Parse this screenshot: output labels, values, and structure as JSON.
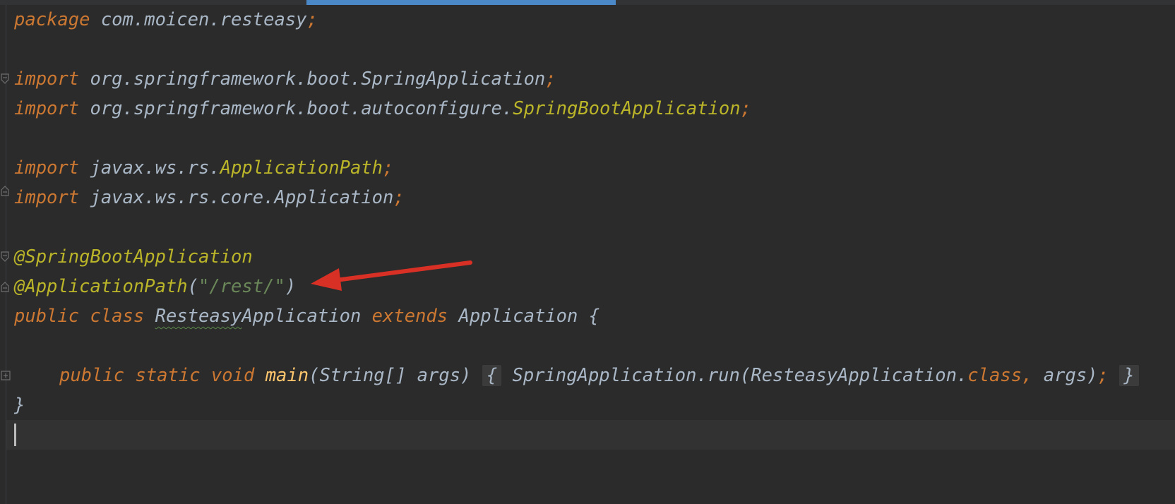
{
  "colors": {
    "background": "#2b2b2b",
    "keyword": "#cc7832",
    "annotation": "#bbb529",
    "string": "#6a8759",
    "method": "#ffc66d",
    "plain": "#a9b7c6",
    "arrow": "#d93025",
    "tab_indicator": "#4a88c7"
  },
  "code": {
    "l1": {
      "kw": "package",
      "pkg": " com.moicen.resteasy",
      "semi": ";"
    },
    "l3": {
      "kw": "import",
      "pkg": " org.springframework.boot.SpringApplication",
      "semi": ";"
    },
    "l4": {
      "kw": "import",
      "pkg": " org.springframework.boot.autoconfigure.",
      "cls": "SpringBootApplication",
      "semi": ";"
    },
    "l6": {
      "kw": "import",
      "pkg": " javax.ws.rs.",
      "cls": "ApplicationPath",
      "semi": ";"
    },
    "l7": {
      "kw": "import",
      "pkg": " javax.ws.rs.core.Application",
      "semi": ";"
    },
    "l9": {
      "anno": "@SpringBootApplication"
    },
    "l10": {
      "anno": "@ApplicationPath",
      "open": "(",
      "str": "\"/rest/\"",
      "close": ")"
    },
    "l11": {
      "kw1": "public class",
      "sp": " ",
      "cls_a": "Resteasy",
      "cls_b": "Application",
      "kw2": " extends",
      "sup": " Application {"
    },
    "l13": {
      "kw": "public static void",
      "sp": " ",
      "method": "main",
      "params": "(String[] args) ",
      "brace_open": "{",
      "body": " SpringApplication.run(ResteasyApplication.",
      "kw_class": "class",
      "comma": ",",
      "args": " args)",
      "semi": ";",
      "brace_close": "}"
    },
    "l14": {
      "text": "}"
    }
  }
}
